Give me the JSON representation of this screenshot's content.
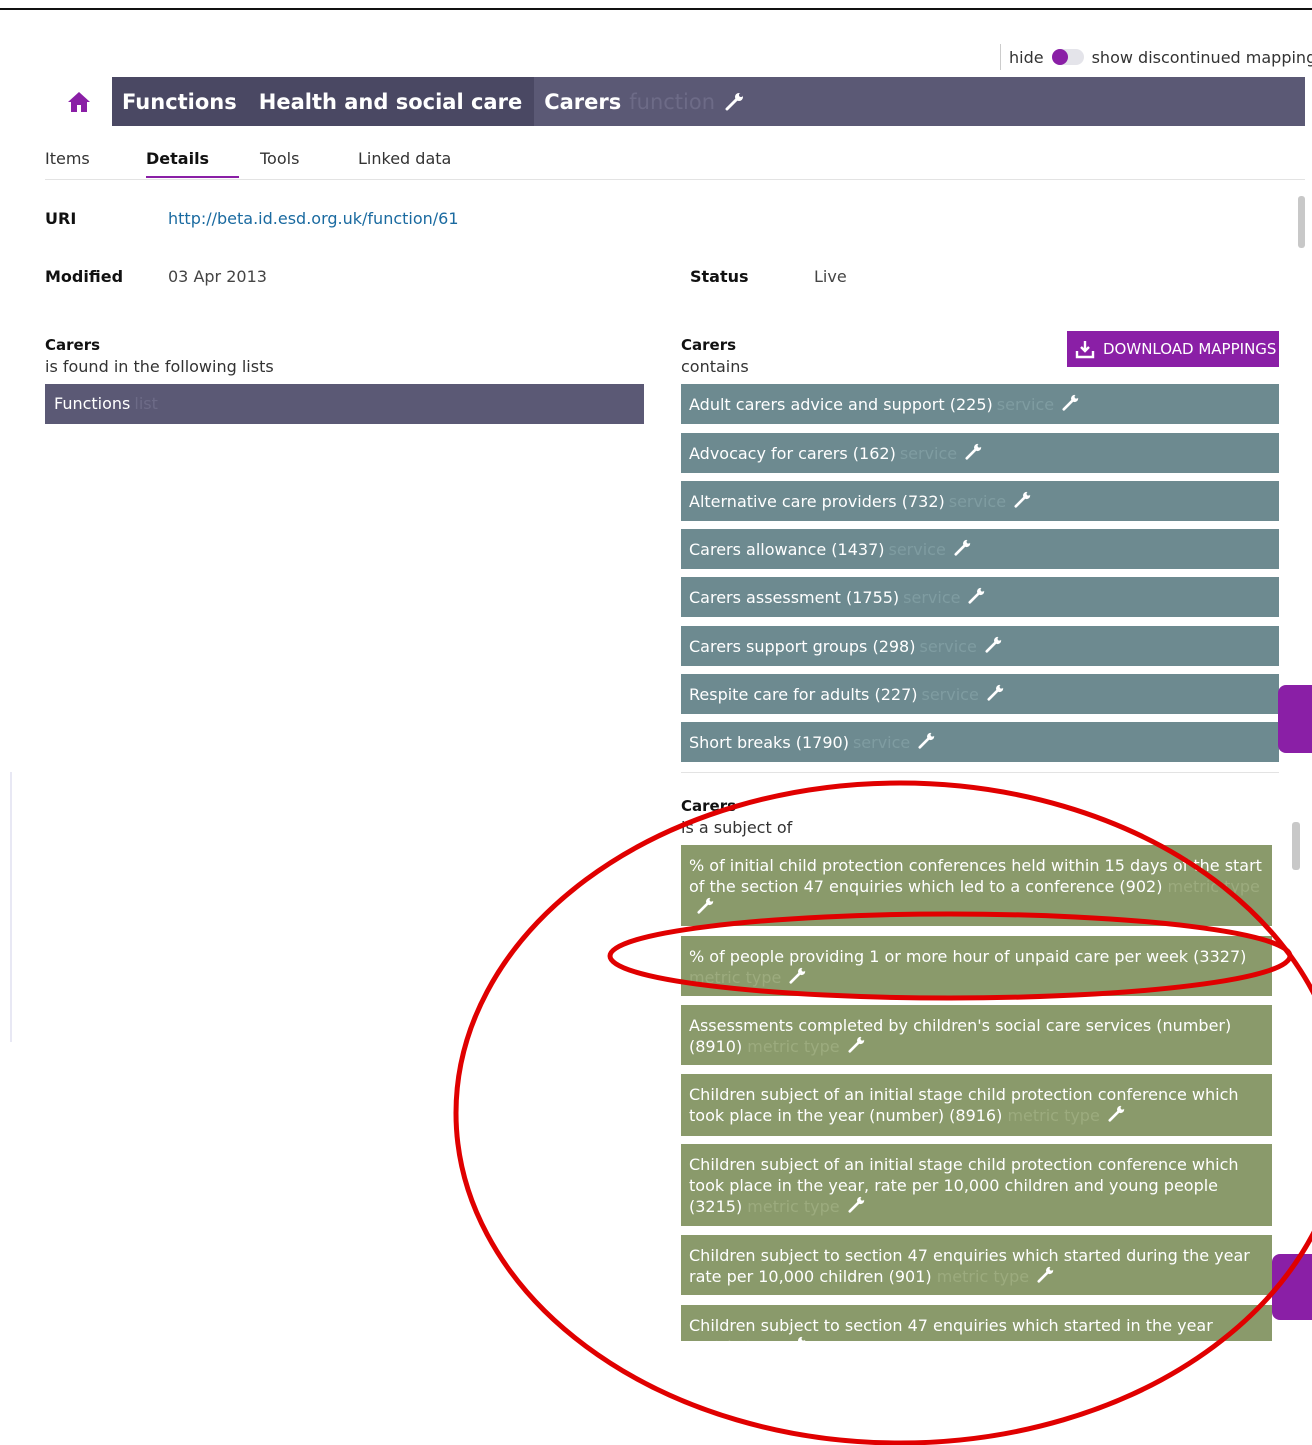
{
  "toggle": {
    "hide_label": "hide",
    "show_label": "show discontinued mappings"
  },
  "breadcrumb": {
    "items": [
      {
        "label": "Functions"
      },
      {
        "label": "Health and social care"
      },
      {
        "label": "Carers",
        "type": "function"
      }
    ]
  },
  "tabs": [
    {
      "label": "Items"
    },
    {
      "label": "Details",
      "active": true
    },
    {
      "label": "Tools"
    },
    {
      "label": "Linked data"
    }
  ],
  "details": {
    "uri_label": "URI",
    "uri_value": "http://beta.id.esd.org.uk/function/61",
    "modified_label": "Modified",
    "modified_value": "03 Apr 2013",
    "status_label": "Status",
    "status_value": "Live"
  },
  "found_in": {
    "title": "Carers",
    "subtitle": "is found in the following lists",
    "items": [
      {
        "label": "Functions",
        "type": "list"
      }
    ]
  },
  "contains": {
    "title": "Carers",
    "subtitle": "contains",
    "download_label": "DOWNLOAD MAPPINGS",
    "items": [
      {
        "label": "Adult carers advice and support (225)",
        "type": "service"
      },
      {
        "label": "Advocacy for carers (162)",
        "type": "service"
      },
      {
        "label": "Alternative care providers (732)",
        "type": "service"
      },
      {
        "label": "Carers allowance (1437)",
        "type": "service"
      },
      {
        "label": "Carers assessment (1755)",
        "type": "service"
      },
      {
        "label": "Carers support groups (298)",
        "type": "service"
      },
      {
        "label": "Respite care for adults (227)",
        "type": "service"
      },
      {
        "label": "Short breaks (1790)",
        "type": "service"
      }
    ]
  },
  "subject_of": {
    "title": "Carers",
    "subtitle": "is a subject of",
    "items": [
      {
        "label": "% of initial child protection conferences held within 15 days of the start of the section 47 enquiries which led to a conference (902)",
        "type": "metric type"
      },
      {
        "label": "% of people providing 1 or more hour of unpaid care per week (3327)",
        "type": "metric type"
      },
      {
        "label": "Assessments completed by children's social care services (number) (8910)",
        "type": "metric type"
      },
      {
        "label": "Children subject of an initial stage child protection conference which took place in the year (number) (8916)",
        "type": "metric type"
      },
      {
        "label": "Children subject of an initial stage child protection conference which took place in the year, rate per 10,000 children and young people (3215)",
        "type": "metric type"
      },
      {
        "label": "Children subject to section 47 enquiries which started during the year rate per 10,000 children (901)",
        "type": "metric type"
      },
      {
        "label": "Children subject to section 47 enquiries which started in the year",
        "type": "metric type"
      }
    ]
  },
  "colors": {
    "accent": "#8a1fa6",
    "breadcrumb_bg": "#5b5975",
    "service_bg": "#6d8a90",
    "metric_bg": "#8a9a6b",
    "annotation": "#e00000"
  },
  "icons": [
    "home-icon",
    "wrench-icon",
    "download-icon"
  ]
}
